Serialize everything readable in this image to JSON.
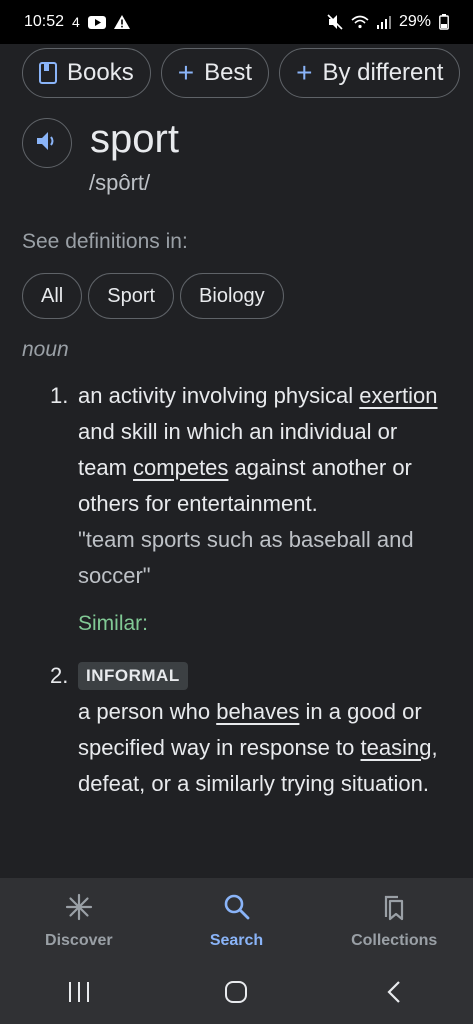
{
  "status_bar": {
    "time": "10:52",
    "notification_count": "4",
    "battery": "29%"
  },
  "chips": [
    {
      "label": "Books",
      "icon": "book-icon"
    },
    {
      "label": "Best",
      "icon": "plus-icon"
    },
    {
      "label": "By different",
      "icon": "plus-icon"
    }
  ],
  "word": {
    "headword": "sport",
    "phonetic": "/spôrt/"
  },
  "see_definitions": {
    "label": "See definitions in:",
    "filters": [
      "All",
      "Sport",
      "Biology"
    ]
  },
  "part_of_speech": "noun",
  "definitions": [
    {
      "number": "1.",
      "text_parts": [
        "an activity involving physical ",
        "exertion",
        " and skill in which an individual or team ",
        "competes",
        " against another or others for entertainment."
      ],
      "example": "\"team sports such as baseball and soccer\"",
      "similar_label": "Similar:"
    },
    {
      "number": "2.",
      "tag": "INFORMAL",
      "text_parts": [
        "a person who ",
        "behaves",
        " in a good or specified way in response to ",
        "teasing",
        ", defeat, or a similarly trying situation."
      ]
    }
  ],
  "bottom_nav": [
    {
      "label": "Discover",
      "icon": "asterisk-icon",
      "active": false
    },
    {
      "label": "Search",
      "icon": "search-icon",
      "active": true
    },
    {
      "label": "Collections",
      "icon": "collections-icon",
      "active": false
    }
  ],
  "colors": {
    "background": "#202124",
    "accent": "#8ab4f8",
    "similar": "#81c995"
  }
}
